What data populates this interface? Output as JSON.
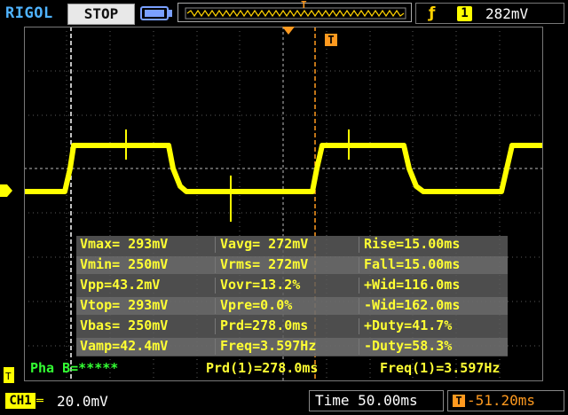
{
  "header": {
    "brand": "RIGOL",
    "run_state": "STOP",
    "trigger_level": "282mV",
    "trigger_channel": "1",
    "trigger_edge_icon": "rising-edge-icon",
    "memory_marker": "T"
  },
  "measurements": [
    [
      "Vmax= 293mV",
      "Vavg= 272mV",
      "Rise=15.00ms"
    ],
    [
      "Vmin= 250mV",
      "Vrms= 272mV",
      "Fall=15.00ms"
    ],
    [
      "Vpp=43.2mV",
      "Vovr=13.2%",
      "+Wid=116.0ms"
    ],
    [
      "Vtop= 293mV",
      "Vpre=0.0%",
      "-Wid=162.0ms"
    ],
    [
      "Vbas= 250mV",
      "Prd=278.0ms",
      "+Duty=41.7%"
    ],
    [
      "Vamp=42.4mV",
      "Freq=3.597Hz",
      "-Duty=58.3%"
    ]
  ],
  "status": {
    "phase": "Pha B=*****",
    "period": "Prd(1)=278.0ms",
    "frequency": "Freq(1)=3.597Hz"
  },
  "footer": {
    "channel": "CH1",
    "coupling": "═",
    "vscale": "20.0mV",
    "timebase": "Time 50.00ms",
    "trigger_marker": "T",
    "trigger_offset": "-51.20ms"
  },
  "markers": {
    "trigger_t": "T"
  },
  "colors": {
    "trace": "#ffff00",
    "trigger": "#ff9a1f",
    "brand": "#4fb3ff",
    "grid": "#5a5a5a"
  },
  "waveform": {
    "high_level_mv": 293,
    "low_level_mv": 250,
    "period_ms": 278,
    "positive_width_ms": 116
  }
}
